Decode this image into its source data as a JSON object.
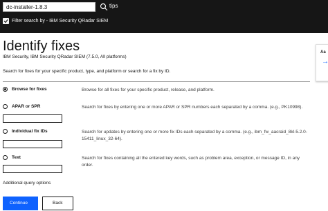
{
  "search": {
    "value": "dc-installer-1.8.3",
    "tips": "tips",
    "filter_label": "Filter search by - IBM Security QRadar SIEM"
  },
  "page": {
    "title": "Identify fixes",
    "product": "IBM Security, IBM Security QRadar SIEM (7.5.0, All platforms)",
    "intro": "Search for fixes for your specific product, type, and platform or search for a fix by ID."
  },
  "options": [
    {
      "label": "Browse for fixes",
      "desc": "Browse for all fixes for your specific product, release, and platform.",
      "checked": true
    },
    {
      "label": "APAR or SPR",
      "desc": "Search for fixes by entering one or more APAR or SPR numbers each separated by a comma. (e.g., PK10998).",
      "checked": false
    },
    {
      "label": "Individual fix IDs",
      "desc": "Search for updates by entering one or more fix IDs each separated by a comma. (e.g., ibm_fw_aacraid_8kl-5.2.0-15411_linux_32-64).",
      "checked": false
    },
    {
      "label": "Text",
      "desc": "Search for fixes containing all the entered key words, such as problem area, exception, or message ID, in any order.",
      "checked": false
    }
  ],
  "additional_options": "Additional query options",
  "buttons": {
    "continue": "Continue",
    "back": "Back"
  },
  "side_card": {
    "title": "Aa"
  },
  "colors": {
    "primary": "#0f62fe",
    "topbar": "#161616"
  }
}
